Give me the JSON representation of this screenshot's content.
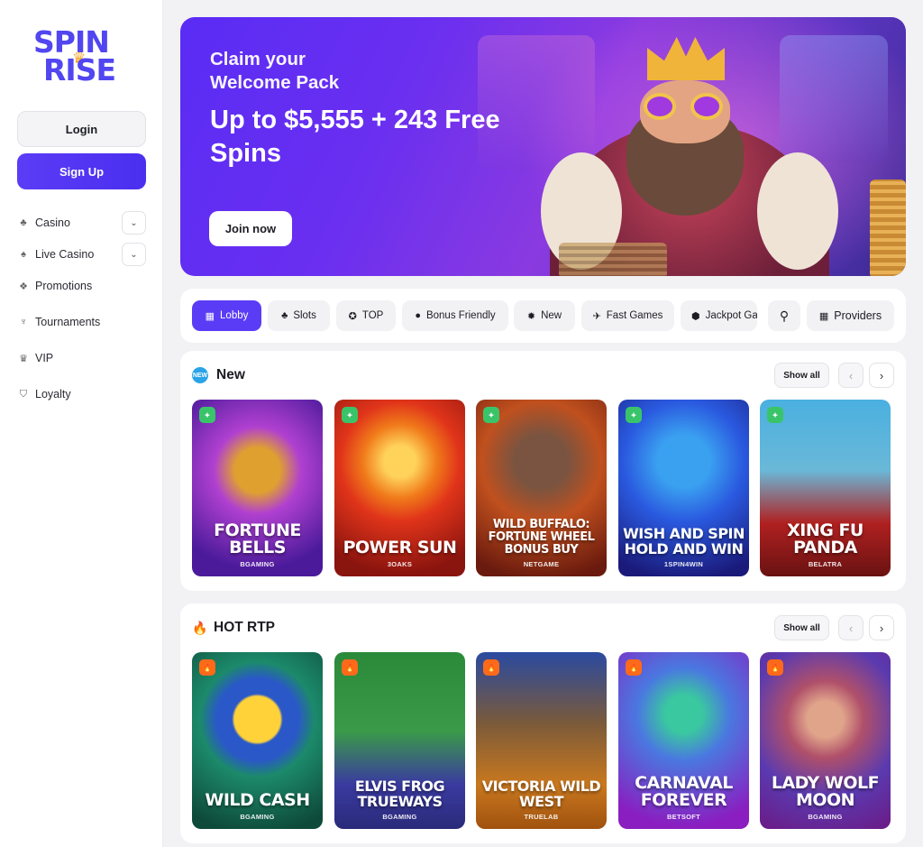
{
  "logo": {
    "line1": "SPIN",
    "line2": "RISE"
  },
  "auth": {
    "login": "Login",
    "signup": "Sign Up"
  },
  "nav": [
    {
      "label": "Casino",
      "icon": "clubs-icon",
      "expandable": true
    },
    {
      "label": "Live Casino",
      "icon": "spade-icon",
      "expandable": true
    },
    {
      "label": "Promotions",
      "icon": "gift-icon",
      "expandable": false
    },
    {
      "label": "Tournaments",
      "icon": "trophy-icon",
      "expandable": false
    },
    {
      "label": "VIP",
      "icon": "crown-icon",
      "expandable": false
    },
    {
      "label": "Loyalty",
      "icon": "shield-icon",
      "expandable": false
    }
  ],
  "banner": {
    "subtitle": "Claim your Welcome Pack",
    "title": "Up to $5,555 + 243 Free Spins",
    "cta": "Join now"
  },
  "tabs": [
    {
      "label": "Lobby",
      "icon": "grid-icon",
      "active": true
    },
    {
      "label": "Slots",
      "icon": "cherries-icon"
    },
    {
      "label": "TOP",
      "icon": "medal-icon"
    },
    {
      "label": "Bonus Friendly",
      "icon": "money-bag-icon"
    },
    {
      "label": "New",
      "icon": "new-icon"
    },
    {
      "label": "Fast Games",
      "icon": "plane-icon"
    },
    {
      "label": "Jackpot Ga",
      "icon": "jackpot-icon"
    }
  ],
  "providers_label": "Providers",
  "sections": [
    {
      "title": "New",
      "badge": "NEW",
      "badge_color": "#2aa3e8",
      "show_all": "Show all",
      "games": [
        {
          "title": "FORTUNE BELLS",
          "provider": "BGAMING",
          "bg": [
            "#6b2cd6",
            "#3a1a8a"
          ]
        },
        {
          "title": "POWER SUN",
          "provider": "3OAKS",
          "bg": [
            "#f06a1a",
            "#b3200f"
          ]
        },
        {
          "title": "WILD BUFFALO: FORTUNE WHEEL BONUS BUY",
          "provider": "NETGAME",
          "bg": [
            "#c5521e",
            "#6e1e0e"
          ]
        },
        {
          "title": "WISH AND SPIN HOLD AND WIN",
          "provider": "1SPIN4WIN",
          "bg": [
            "#3a6ae0",
            "#1b2c9a"
          ]
        },
        {
          "title": "XING FU PANDA",
          "provider": "BELATRA",
          "bg": [
            "#3aa0d8",
            "#8a1d1d"
          ]
        }
      ]
    },
    {
      "title": "HOT RTP",
      "badge": "🔥",
      "badge_color": "#ff6a1a",
      "show_all": "Show all",
      "games": [
        {
          "title": "WILD CASH",
          "provider": "BGAMING",
          "bg": [
            "#1c8a6a",
            "#0e4a3a"
          ]
        },
        {
          "title": "ELVIS FROG TRUEWAYS",
          "provider": "BGAMING",
          "bg": [
            "#2a7a3a",
            "#4a3aa0"
          ]
        },
        {
          "title": "VICTORIA WILD WEST",
          "provider": "TRUELAB",
          "bg": [
            "#2a4a9a",
            "#c9781e"
          ]
        },
        {
          "title": "CARNAVAL FOREVER",
          "provider": "BETSOFT",
          "bg": [
            "#3a6ad0",
            "#8a1ec0"
          ]
        },
        {
          "title": "LADY WOLF MOON",
          "provider": "BGAMING",
          "bg": [
            "#3a3ab0",
            "#7a1e9a"
          ]
        }
      ]
    }
  ]
}
